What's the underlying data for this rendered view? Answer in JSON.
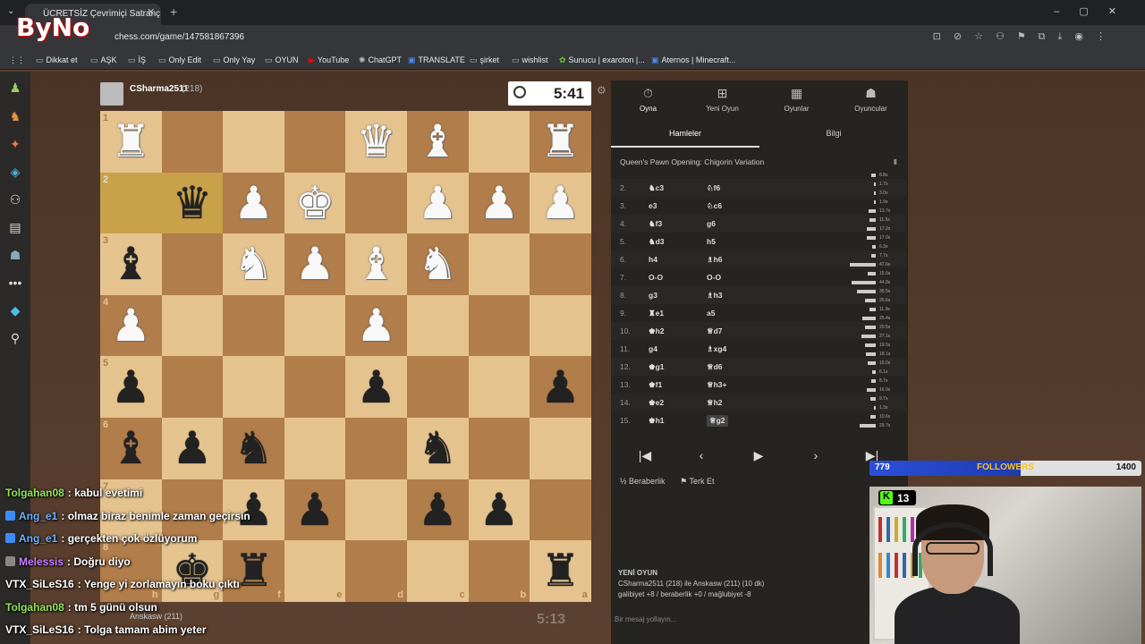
{
  "browser": {
    "tab_title": "ÜCRETSİZ Çevrimiçi Satranç Oyna",
    "url": "chess.com/game/147581867396",
    "bookmarks": [
      {
        "label": "Dikkat et",
        "icon": "folder-icon"
      },
      {
        "label": "AŞK",
        "icon": "folder-icon"
      },
      {
        "label": "İŞ",
        "icon": "folder-icon"
      },
      {
        "label": "Only Edit",
        "icon": "folder-icon"
      },
      {
        "label": "Only Yay",
        "icon": "folder-icon"
      },
      {
        "label": "OYUN",
        "icon": "folder-icon"
      },
      {
        "label": "YouTube",
        "icon": "youtube-icon"
      },
      {
        "label": "ChatGPT",
        "icon": "chatgpt-icon"
      },
      {
        "label": "TRANSLATE",
        "icon": "translate-icon"
      },
      {
        "label": "şirket",
        "icon": "folder-icon"
      },
      {
        "label": "wishlist",
        "icon": "folder-icon"
      },
      {
        "label": "Sunucu | exaroton |...",
        "icon": "exaroton-icon"
      },
      {
        "label": "Aternos | Minecraft...",
        "icon": "aternos-icon"
      }
    ]
  },
  "logo": {
    "text": "ByNo"
  },
  "game": {
    "top_player": {
      "name": "CSharma2511",
      "rating": "(218)",
      "clock": "5:41"
    },
    "bottom_player": {
      "name": "Anskasw",
      "rating": "(211)",
      "clock": "5:13"
    },
    "board": [
      [
        "wR",
        "",
        "",
        "",
        "wQ",
        "wB",
        "",
        "wR"
      ],
      [
        "",
        "bQ",
        "wP",
        "wK",
        "",
        "wP",
        "wP",
        "wP"
      ],
      [
        "bB",
        "",
        "wN",
        "wP",
        "wB",
        "wN",
        "",
        ""
      ],
      [
        "wP",
        "",
        "",
        "",
        "wP",
        "",
        "",
        ""
      ],
      [
        "bP",
        "",
        "",
        "",
        "bP",
        "",
        "",
        "bP"
      ],
      [
        "bB",
        "bP",
        "bN",
        "",
        "",
        "bN",
        "",
        ""
      ],
      [
        "",
        "",
        "bP",
        "bP",
        "",
        "bP",
        "bP",
        ""
      ],
      [
        "",
        "bK",
        "bR",
        "",
        "",
        "",
        "",
        "bR"
      ]
    ],
    "ranks": [
      "1",
      "2",
      "3",
      "4",
      "5",
      "6",
      "7",
      "8"
    ],
    "files": [
      "h",
      "g",
      "f",
      "e",
      "d",
      "c",
      "b",
      "a"
    ]
  },
  "panel": {
    "nav": [
      {
        "label": "Oyna",
        "icon": "stopwatch-icon"
      },
      {
        "label": "Yeni Oyun",
        "icon": "plus-icon"
      },
      {
        "label": "Oyunlar",
        "icon": "board-icon"
      },
      {
        "label": "Oyuncular",
        "icon": "players-icon"
      }
    ],
    "tabs": [
      "Hamleler",
      "Bilgi"
    ],
    "opening": "Queen's Pawn Opening: Chigorin Variation",
    "moves": [
      {
        "n": "2.",
        "w": "♞c3",
        "b": "♘f6"
      },
      {
        "n": "3.",
        "w": "e3",
        "b": "♘c6"
      },
      {
        "n": "4.",
        "w": "♞f3",
        "b": "g6"
      },
      {
        "n": "5.",
        "w": "♞d3",
        "b": "h5"
      },
      {
        "n": "6.",
        "w": "h4",
        "b": "♗h6"
      },
      {
        "n": "7.",
        "w": "O-O",
        "b": "O-O"
      },
      {
        "n": "8.",
        "w": "g3",
        "b": "♗h3"
      },
      {
        "n": "9.",
        "w": "♜e1",
        "b": "a5"
      },
      {
        "n": "10.",
        "w": "♚h2",
        "b": "♕d7"
      },
      {
        "n": "11.",
        "w": "g4",
        "b": "♗xg4"
      },
      {
        "n": "12.",
        "w": "♚g1",
        "b": "♕d6"
      },
      {
        "n": "13.",
        "w": "♚f1",
        "b": "♕h3+"
      },
      {
        "n": "14.",
        "w": "♚e2",
        "b": "♕h2"
      },
      {
        "n": "15.",
        "w": "♚h1",
        "b": "♕g2"
      }
    ],
    "times": [
      "8.8s",
      "1.7s",
      "3.0s",
      "1.9s",
      "13.7s",
      "11.5s",
      "17.2s",
      "17.0s",
      "6.3s",
      "7.7s",
      "47.6s",
      "15.6s",
      "44.8s",
      "35.5s",
      "20.6s",
      "11.9s",
      "25.4s",
      "20.5s",
      "27.1s",
      "19.5s",
      "18.1s",
      "15.0s",
      "6.1s",
      "8.7s",
      "16.9s",
      "9.7s",
      "1.3s",
      "10.6s",
      "29.7s"
    ],
    "actions": {
      "draw": "Beraberlik",
      "resign": "Terk Et"
    },
    "new_game": {
      "title": "YENİ OYUN",
      "line1": "CSharma2511 (218) ile Anskasw (211) (10 dk)",
      "line2": "galibiyet +8 / beraberlik +0 / mağlubiyet -8"
    },
    "chat_placeholder": "Bir mesaj yollayın..."
  },
  "followers": {
    "current": "779",
    "label": "FOLLOWERS",
    "goal": "1400",
    "progress": 0.556
  },
  "viewers": {
    "count": "13"
  },
  "chat": [
    {
      "user": "Tolgahan08",
      "color": "#8ee35c",
      "msg": ": kabul evetimi",
      "badge": ""
    },
    {
      "user": "Ang_e1",
      "color": "#6ab0ff",
      "msg": ": olmaz biraz benimle zaman geçirsin",
      "badge": "#3c8cff"
    },
    {
      "user": "Ang_e1",
      "color": "#6ab0ff",
      "msg": ": gerçekten çok özlüyorum",
      "badge": "#3c8cff"
    },
    {
      "user": "Melessis",
      "color": "#c77dff",
      "msg": ": Doğru diyo",
      "badge": "#888"
    },
    {
      "user": "VTX_SiLeS16",
      "color": "#ffffff",
      "msg": ": Yenge yi zorlamayın boku çıktı",
      "badge": ""
    },
    {
      "user": "Tolgahan08",
      "color": "#8ee35c",
      "msg": ": tm 5 günü olsun",
      "badge": ""
    },
    {
      "user": "VTX_SiLeS16",
      "color": "#ffffff",
      "msg": ": Tolga tamam abim yeter",
      "badge": ""
    }
  ]
}
